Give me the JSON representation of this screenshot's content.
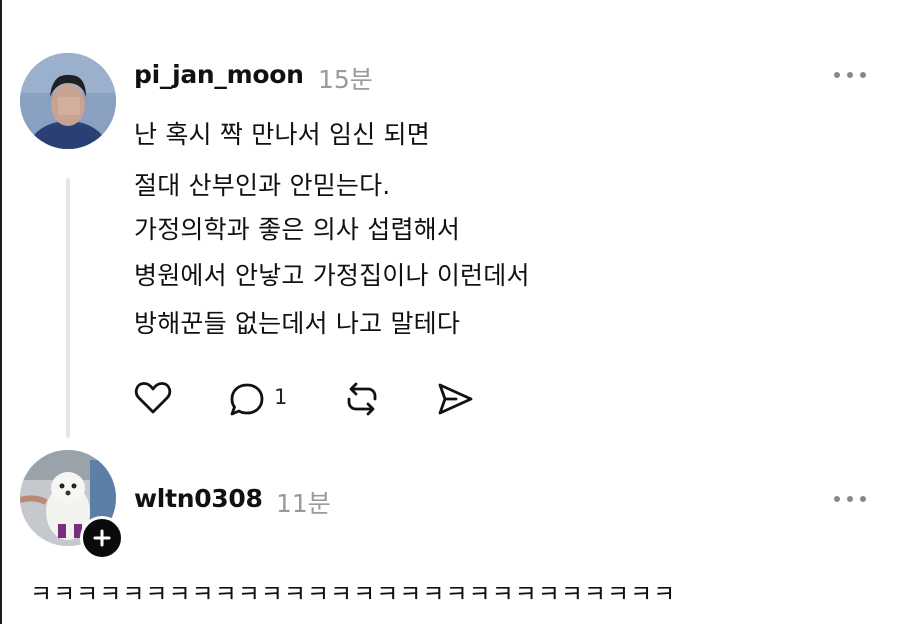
{
  "posts": [
    {
      "username": "pi_jan_moon",
      "time": "15분",
      "lines": [
        "난 혹시 짝 만나서 임신 되면",
        "절대 산부인과 안믿는다.",
        "가정의학과 좋은 의사 섭렵해서",
        "병원에서 안낳고 가정집이나 이런데서",
        "방해꾼들 없는데서 나고 말테다"
      ],
      "actions": {
        "like_icon": "heart-icon",
        "reply_icon": "comment-icon",
        "reply_count": "1",
        "repost_icon": "repost-icon",
        "share_icon": "send-icon"
      }
    },
    {
      "username": "wltn0308",
      "time": "11분",
      "text": "ㅋㅋㅋㅋㅋㅋㅋㅋㅋㅋㅋㅋㅋㅋㅋㅋㅋㅋㅋㅋㅋㅋㅋㅋㅋㅋㅋㅋ",
      "badge_icon": "plus-icon"
    }
  ],
  "colors": {
    "text": "#111111",
    "muted": "#9a9a9a",
    "thread_line": "#e6e6e6"
  }
}
